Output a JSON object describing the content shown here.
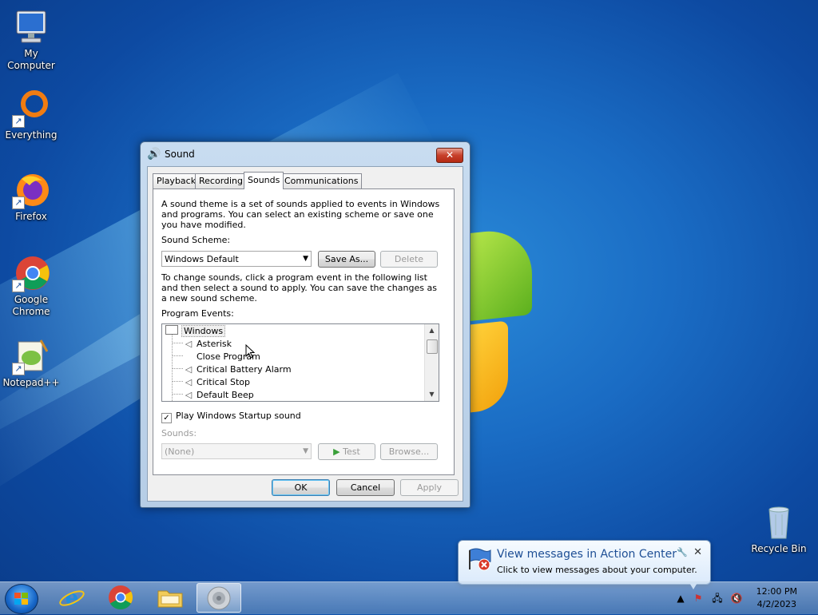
{
  "desktop": {
    "icons": [
      {
        "label": "My Computer"
      },
      {
        "label": "Everything"
      },
      {
        "label": "Firefox"
      },
      {
        "label": "Google Chrome"
      },
      {
        "label": "Notepad++"
      },
      {
        "label": "Recycle Bin"
      }
    ]
  },
  "dialog": {
    "title": "Sound",
    "close_label": "✕",
    "tabs": [
      {
        "label": "Playback"
      },
      {
        "label": "Recording"
      },
      {
        "label": "Sounds",
        "active": true
      },
      {
        "label": "Communications"
      }
    ],
    "intro_text": "A sound theme is a set of sounds applied to events in Windows and programs.  You can select an existing scheme or save one you have modified.",
    "scheme_label": "Sound Scheme:",
    "scheme_value": "Windows Default",
    "save_as_label": "Save As...",
    "delete_label": "Delete",
    "change_text": "To change sounds, click a program event in the following list and then select a sound to apply.  You can save the changes as a new sound scheme.",
    "events_label": "Program Events:",
    "events_group": "Windows",
    "events": [
      {
        "label": "Asterisk",
        "has_sound": true
      },
      {
        "label": "Close Program",
        "has_sound": false
      },
      {
        "label": "Critical Battery Alarm",
        "has_sound": true
      },
      {
        "label": "Critical Stop",
        "has_sound": true
      },
      {
        "label": "Default Beep",
        "has_sound": true
      }
    ],
    "startup_label": "Play Windows Startup sound",
    "startup_checked": true,
    "sounds_label": "Sounds:",
    "sounds_value": "(None)",
    "test_label": "Test",
    "browse_label": "Browse...",
    "ok_label": "OK",
    "cancel_label": "Cancel",
    "apply_label": "Apply"
  },
  "taskbar": {
    "apps": [
      {
        "name": "internet-explorer"
      },
      {
        "name": "google-chrome"
      },
      {
        "name": "file-explorer"
      },
      {
        "name": "sound-control-panel",
        "active": true
      }
    ],
    "time": "12:00 PM",
    "date": "4/2/2023"
  },
  "notification": {
    "title": "View messages in Action Center",
    "text": "Click to view messages about your computer."
  }
}
